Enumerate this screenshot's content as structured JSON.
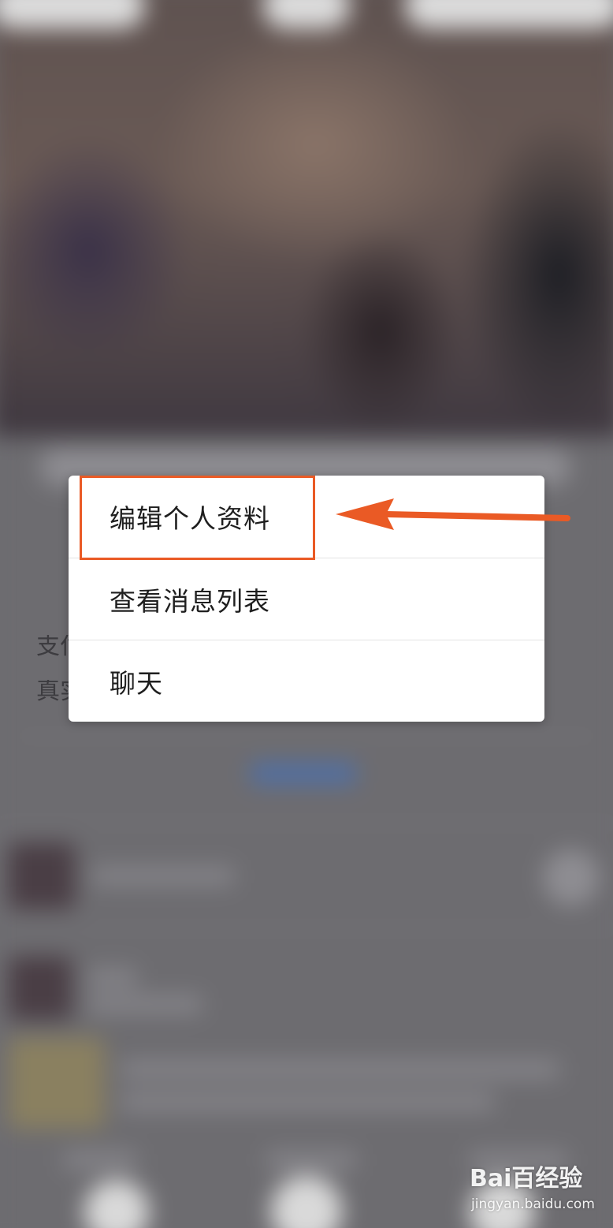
{
  "menu": {
    "items": [
      {
        "label": "编辑个人资料"
      },
      {
        "label": "查看消息列表"
      },
      {
        "label": "聊天"
      }
    ]
  },
  "background": {
    "partial_text_1": "支付",
    "partial_text_2": "真实"
  },
  "annotation": {
    "highlight_color": "#ea5a25",
    "arrow_color": "#ea5a25"
  },
  "watermark": {
    "brand": "Bai百经验",
    "url": "jingyan.baidu.com"
  }
}
